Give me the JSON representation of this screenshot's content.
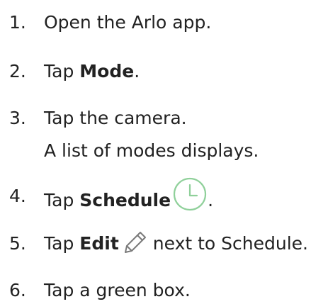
{
  "steps": [
    {
      "number": "1.",
      "text": "Open the Arlo app."
    },
    {
      "number": "2.",
      "pre": "Tap ",
      "bold": "Mode",
      "post": "."
    },
    {
      "number": "3.",
      "text": "Tap the camera.",
      "subtext": "A list of modes displays."
    },
    {
      "number": "4.",
      "pre": "Tap ",
      "bold": "Schedule",
      "post": ".",
      "icon": "clock-icon"
    },
    {
      "number": "5.",
      "pre": "Tap ",
      "bold": "Edit",
      "post": "next to Schedule.",
      "icon": "pencil-icon"
    },
    {
      "number": "6.",
      "text": "Tap a green box."
    }
  ],
  "colors": {
    "text": "#222222",
    "clock_icon": "#8fd09a",
    "pencil_icon": "#7a7a7a"
  }
}
